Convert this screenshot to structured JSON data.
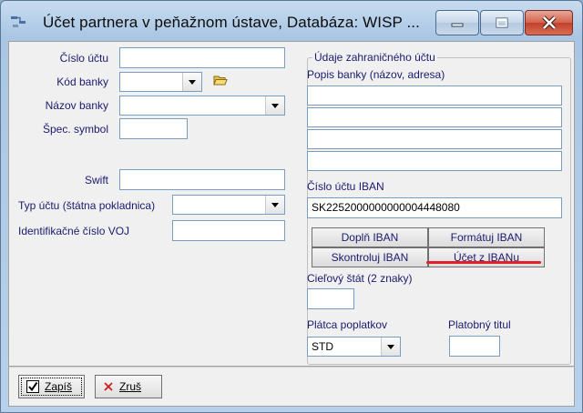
{
  "window": {
    "title": "Účet partnera v peňažnom ústave,  Databáza: WISP ..."
  },
  "left": {
    "cislo_uctu_label": "Číslo účtu",
    "cislo_uctu_value": "",
    "kod_banky_label": "Kód banky",
    "kod_banky_value": "",
    "nazov_banky_label": "Názov banky",
    "nazov_banky_value": "",
    "spec_symbol_label": "Špec. symbol",
    "spec_symbol_value": "",
    "swift_label": "Swift",
    "swift_value": "",
    "typ_uctu_label": "Typ účtu (štátna pokladnica)",
    "typ_uctu_value": "",
    "id_voj_label": "Identifikačné číslo VOJ",
    "id_voj_value": ""
  },
  "foreign": {
    "group_title": "Údaje zahraničného účtu",
    "popis_banky_label": "Popis banky (názov, adresa)",
    "popis_lines": [
      "",
      "",
      "",
      ""
    ],
    "iban_label": "Číslo účtu IBAN",
    "iban_value": "SK2252000000000004448080",
    "btn_dopln": "Doplň IBAN",
    "btn_formatuj": "Formátuj IBAN",
    "btn_skontroluj": "Skontroluj IBAN",
    "btn_ucet_z_iban": "Účet z IBANu",
    "ciel_stat_label": "Cieľový štát (2 znaky)",
    "ciel_stat_value": "",
    "platca_label": "Plátca poplatkov",
    "platca_value": "STD",
    "platobny_titul_label": "Platobný titul",
    "platobny_titul_value": ""
  },
  "footer": {
    "zapis_label": "Zapíš",
    "zrus_label": "Zruš"
  },
  "colors": {
    "accent_red": "#e0202a",
    "label_text": "#1a1a6e"
  }
}
